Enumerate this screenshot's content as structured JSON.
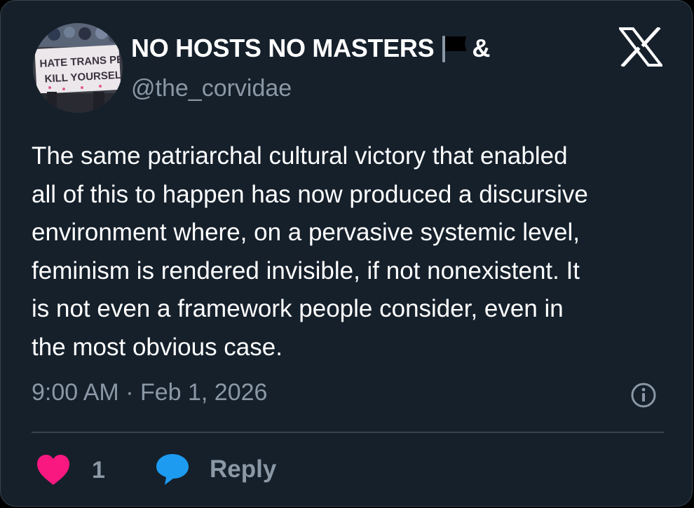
{
  "author": {
    "display_name": "NO HOSTS NO MASTERS",
    "name_suffix": "&",
    "flag_icon": "black-flag-icon",
    "handle": "@the_corvidae",
    "avatar_sign_text": "HATE TRANS PEOPLE? KILL YOURSELF!"
  },
  "platform_logo": "x-logo-icon",
  "tweet": {
    "lines": [
      "The same patriarchal cultural victory that enabled",
      "all of this to happen has now produced a discursive",
      "environment where, on a pervasive systemic level,",
      "feminism is rendered invisible, if not nonexistent. It",
      "is not even a framework people consider, even in",
      "the most obvious case."
    ],
    "timestamp": "9:00 AM · Feb 1, 2026"
  },
  "actions": {
    "like_count": "1",
    "reply_label": "Reply"
  },
  "colors": {
    "background": "#15202b",
    "text": "#ffffff",
    "muted": "#8b98a5",
    "like": "#f91880",
    "reply": "#1d9bf0",
    "border": "#38444d"
  }
}
